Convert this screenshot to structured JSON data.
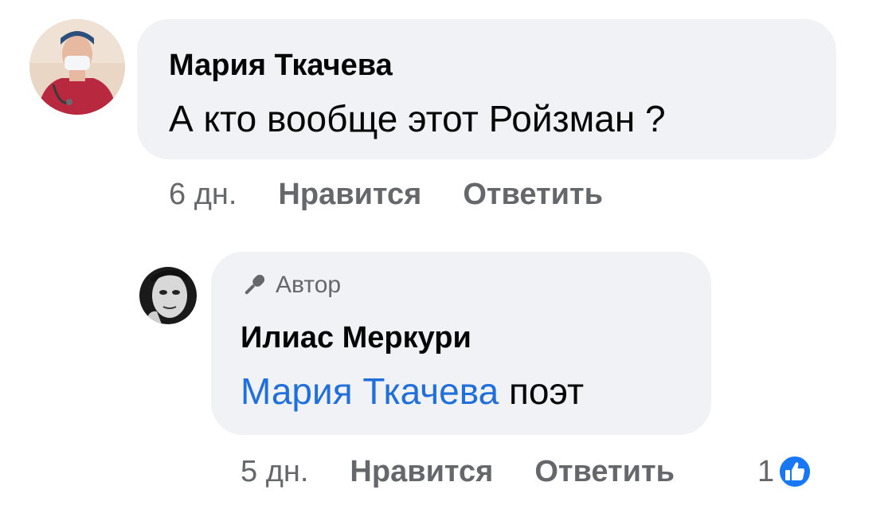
{
  "comments": [
    {
      "author": "Мария Ткачева",
      "text": "А кто вообще этот Ройзман ?",
      "time": "6 дн.",
      "like_label": "Нравится",
      "reply_label": "Ответить"
    },
    {
      "badge": "Автор",
      "author": "Илиас Меркури",
      "mention": "Мария Ткачева",
      "text": "поэт",
      "time": "5 дн.",
      "like_label": "Нравится",
      "reply_label": "Ответить",
      "like_count": "1"
    }
  ],
  "icons": {
    "badge_icon": "microphone-icon",
    "reaction_icon": "like-thumb-icon"
  },
  "colors": {
    "bubble": "#f0f2f5",
    "mention": "#216fdb",
    "meta_text": "#65676b",
    "like_badge": "#1877f2"
  }
}
